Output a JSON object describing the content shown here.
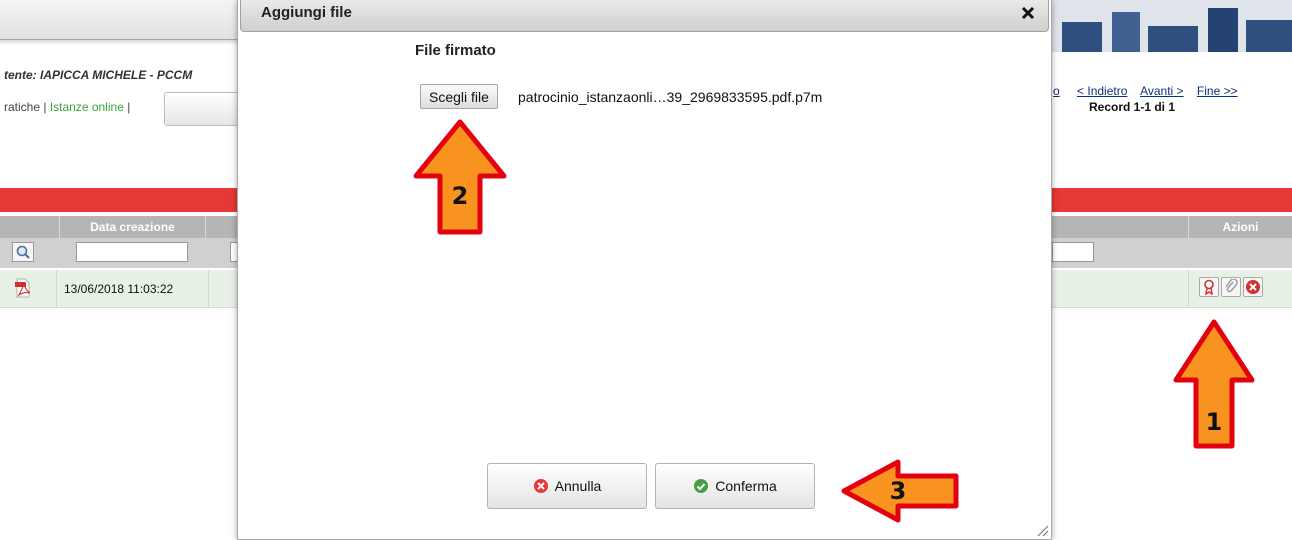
{
  "background": {
    "utente_text": "tente: IAPICCA MICHELE - PCCM",
    "nav_pratiche": "ratiche | ",
    "nav_istanze": "Istanze online",
    "nav_sep": " |",
    "paging": {
      "partial": "o",
      "prev": "< Indietro",
      "next": "Avanti >",
      "end": "Fine >>",
      "record": "Record 1-1 di 1"
    },
    "columns": {
      "data_creazione": "Data creazione",
      "azioni": "Azioni"
    },
    "row": {
      "date": "13/06/2018 11:03:22"
    }
  },
  "modal": {
    "title": "Aggiungi file",
    "close_glyph": "✖",
    "field_label": "File firmato",
    "file_button": "Scegli file",
    "file_name": "patrocinio_istanzaonli…39_2969833595.pdf.p7m",
    "cancel_label": "Annulla",
    "confirm_label": "Conferma"
  },
  "annotations": {
    "step1": "1",
    "step2": "2",
    "step3": "3"
  },
  "colors": {
    "red_bar": "#e53935",
    "arrow_fill": "#f7931e",
    "arrow_stroke": "#e3000f",
    "row_bg": "#e8f1e6"
  }
}
